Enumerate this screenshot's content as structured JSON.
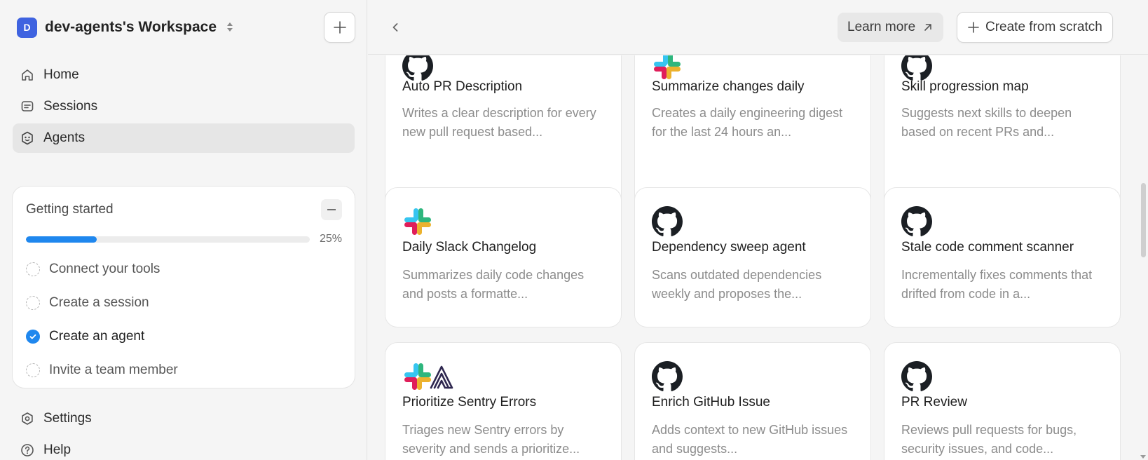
{
  "workspace": {
    "initial": "D",
    "name": "dev-agents's Workspace"
  },
  "nav": [
    {
      "label": "Home",
      "icon": "home-icon"
    },
    {
      "label": "Sessions",
      "icon": "sessions-icon"
    },
    {
      "label": "Agents",
      "icon": "agents-icon",
      "active": true
    }
  ],
  "getting_started": {
    "title": "Getting started",
    "progress_pct": 25,
    "progress_label": "25%",
    "steps": [
      {
        "label": "Connect your tools",
        "done": false
      },
      {
        "label": "Create a session",
        "done": false
      },
      {
        "label": "Create an agent",
        "done": true
      },
      {
        "label": "Invite a team member",
        "done": false
      }
    ]
  },
  "bottom_nav": [
    {
      "label": "Settings",
      "icon": "settings-icon"
    },
    {
      "label": "Help",
      "icon": "help-icon"
    }
  ],
  "header": {
    "learn_more": "Learn more",
    "create_from_scratch": "Create from scratch"
  },
  "cards": [
    {
      "title": "Auto PR Description",
      "desc": "Writes a clear description for every new pull request based...",
      "logos": [
        "github-logo"
      ]
    },
    {
      "title": "Summarize changes daily",
      "desc": "Creates a daily engineering digest for the last 24 hours an...",
      "logos": [
        "slack-logo"
      ]
    },
    {
      "title": "Skill progression map",
      "desc": "Suggests next skills to deepen based on recent PRs and...",
      "logos": [
        "github-logo"
      ]
    },
    {
      "title": "Daily Slack Changelog",
      "desc": "Summarizes daily code changes and posts a formatte...",
      "logos": [
        "slack-logo"
      ]
    },
    {
      "title": "Dependency sweep agent",
      "desc": "Scans outdated dependencies weekly and proposes the...",
      "logos": [
        "github-logo"
      ]
    },
    {
      "title": "Stale code comment scanner",
      "desc": "Incrementally fixes comments that drifted from code in a...",
      "logos": [
        "github-logo"
      ]
    },
    {
      "title": "Prioritize Sentry Errors",
      "desc": "Triages new Sentry errors by severity and sends a prioritize...",
      "logos": [
        "slack-logo",
        "sentry-logo"
      ]
    },
    {
      "title": "Enrich GitHub Issue",
      "desc": "Adds context to new GitHub issues and suggests...",
      "logos": [
        "github-logo"
      ]
    },
    {
      "title": "PR Review",
      "desc": "Reviews pull requests for bugs, security issues, and code...",
      "logos": [
        "github-logo"
      ]
    }
  ],
  "colors": {
    "accent": "#1f87ee",
    "workspace_avatar": "#3f63e0"
  }
}
